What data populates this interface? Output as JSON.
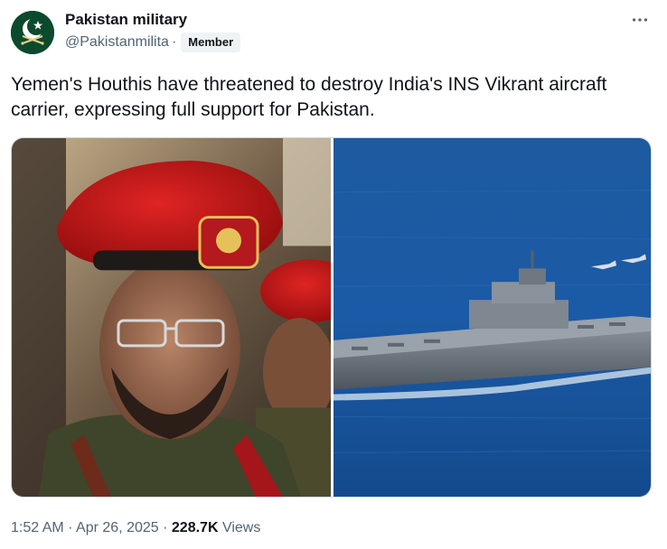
{
  "author": {
    "display_name": "Pakistan military",
    "handle": "@Pakistanmilita",
    "separator": "·",
    "badge": "Member",
    "avatar": {
      "icon": "crescent-star-swords-logo",
      "bg_color": "#0b4a2c"
    }
  },
  "tweet": {
    "text": "Yemen's Houthis have threatened to destroy India's INS Vikrant aircraft carrier, expressing full support for Pakistan."
  },
  "media": {
    "images": [
      {
        "name": "military-officer-red-beret-photo"
      },
      {
        "name": "aircraft-carrier-at-sea-photo"
      }
    ]
  },
  "meta": {
    "time": "1:52 AM",
    "date": "Apr 26, 2025",
    "views_count": "228.7K",
    "views_label": "Views",
    "sep": "·"
  },
  "colors": {
    "text_primary": "#0f1419",
    "text_secondary": "#536471",
    "badge_bg": "#eff3f4",
    "sea": "#1f5fa3"
  },
  "icons": {
    "more": "more-horizontal-icon"
  }
}
